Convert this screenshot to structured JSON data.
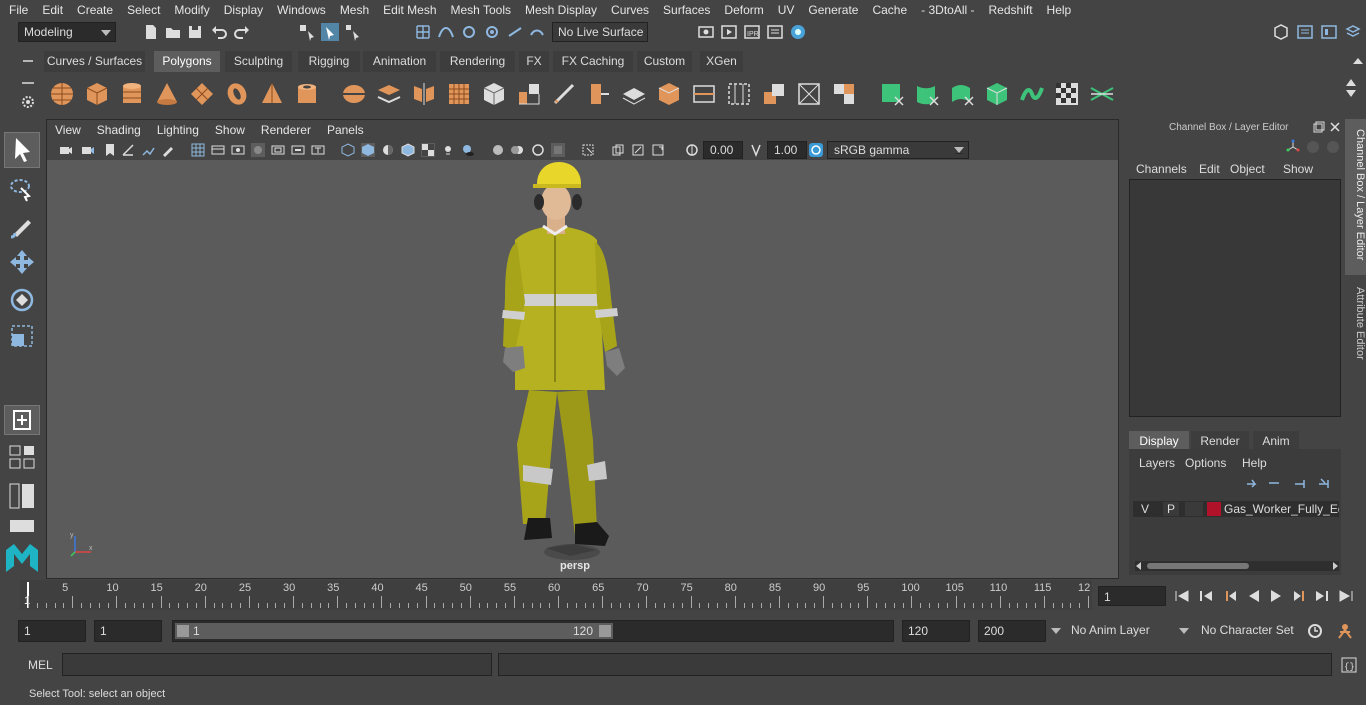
{
  "menubar": [
    "File",
    "Edit",
    "Create",
    "Select",
    "Modify",
    "Display",
    "Windows",
    "Mesh",
    "Edit Mesh",
    "Mesh Tools",
    "Mesh Display",
    "Curves",
    "Surfaces",
    "Deform",
    "UV",
    "Generate",
    "Cache",
    "- 3DtoAll -",
    "Redshift",
    "Help"
  ],
  "statusline": {
    "mode": "Modeling",
    "live_surface": "No Live Surface"
  },
  "shelf_tabs": [
    "Curves / Surfaces",
    "Polygons",
    "Sculpting",
    "Rigging",
    "Animation",
    "Rendering",
    "FX",
    "FX Caching",
    "Custom",
    "XGen"
  ],
  "active_shelf_tab": "Polygons",
  "viewport": {
    "menu": [
      "View",
      "Shading",
      "Lighting",
      "Show",
      "Renderer",
      "Panels"
    ],
    "exposure": "0.00",
    "gamma": "1.00",
    "colorspace": "sRGB gamma",
    "camera_label": "persp"
  },
  "channel_box": {
    "title": "Channel Box / Layer Editor",
    "menu": [
      "Channels",
      "Edit",
      "Object",
      "Show"
    ]
  },
  "layer_editor": {
    "tabs": [
      "Display",
      "Render",
      "Anim"
    ],
    "active_tab": "Display",
    "menu": [
      "Layers",
      "Options",
      "Help"
    ],
    "layer": {
      "v": "V",
      "p": "P",
      "name": "Gas_Worker_Fully_Equ",
      "color": "#b0122a"
    }
  },
  "side_tabs": [
    "Channel Box / Layer Editor",
    "Attribute Editor"
  ],
  "timeline": {
    "ticks": [
      "5",
      "10",
      "15",
      "20",
      "25",
      "30",
      "35",
      "40",
      "45",
      "50",
      "55",
      "60",
      "65",
      "70",
      "75",
      "80",
      "85",
      "90",
      "95",
      "100",
      "105",
      "110",
      "115",
      "12"
    ],
    "start_marker": "1",
    "current_frame": "1"
  },
  "range": {
    "start": "1",
    "playback_start": "1",
    "slider_start": "1",
    "slider_end": "120",
    "playback_end": "120",
    "end": "200",
    "anim_layer": "No Anim Layer",
    "character_set": "No Character Set"
  },
  "cmdline": {
    "lang": "MEL"
  },
  "helpline": "Select Tool: select an object"
}
